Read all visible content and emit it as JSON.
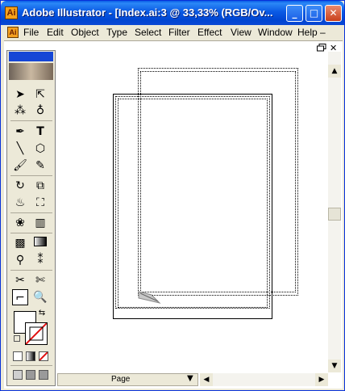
{
  "window": {
    "title": "Adobe Illustrator - [Index.ai:3 @ 33,33% (RGB/Ov...",
    "minimize": "_",
    "maximize": "□",
    "close": "✕"
  },
  "menu": {
    "items": [
      "File",
      "Edit",
      "Object",
      "Type",
      "Select",
      "Filter",
      "Effect",
      "View",
      "Window",
      "Help"
    ],
    "doc_minimize": "–"
  },
  "status": {
    "page_label": "Page"
  },
  "colors": {
    "title_bar": "#0a5ae4",
    "chrome": "#ece9d8",
    "toolbox_header": "#1546d6",
    "canvas": "#ffffff"
  },
  "tools": [
    "selection-icon",
    "direct-selection-icon",
    "magic-wand-icon",
    "lasso-icon",
    "pen-icon",
    "type-icon",
    "line-segment-icon",
    "ellipse-icon",
    "paintbrush-icon",
    "pencil-icon",
    "rotate-icon",
    "scale-icon",
    "warp-icon",
    "free-transform-icon",
    "symbol-sprayer-icon",
    "graph-icon",
    "mesh-icon",
    "gradient-icon",
    "eyedropper-icon",
    "blend-icon",
    "slice-icon",
    "scissors-icon",
    "page-tool-icon",
    "zoom-icon"
  ]
}
